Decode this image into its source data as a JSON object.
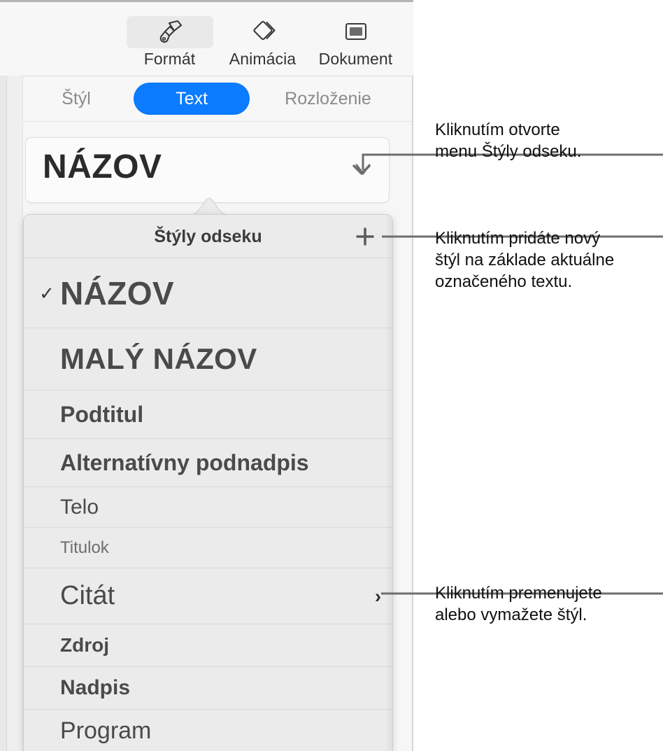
{
  "toolbar": {
    "items": [
      {
        "label": "Formát",
        "icon": "paintbrush-icon",
        "selected": true
      },
      {
        "label": "Animácia",
        "icon": "diamonds-icon",
        "selected": false
      },
      {
        "label": "Dokument",
        "icon": "document-frame-icon",
        "selected": false
      }
    ]
  },
  "tabs": {
    "items": [
      {
        "label": "Štýl",
        "selected": false
      },
      {
        "label": "Text",
        "selected": true
      },
      {
        "label": "Rozloženie",
        "selected": false
      }
    ],
    "accent_color": "#0b7bff"
  },
  "style_field": {
    "value": "NÁZOV",
    "chevron_icon": "chevron-down-icon"
  },
  "popup": {
    "title": "Štýly odseku",
    "add_icon": "plus-icon",
    "rows": [
      {
        "label": "NÁZOV",
        "checked": true,
        "submenu": false,
        "class": "r-nazov"
      },
      {
        "label": "MALÝ NÁZOV",
        "checked": false,
        "submenu": false,
        "class": "r-maly"
      },
      {
        "label": "Podtitul",
        "checked": false,
        "submenu": false,
        "class": "r-podtitul"
      },
      {
        "label": "Alternatívny podnadpis",
        "checked": false,
        "submenu": false,
        "class": "r-alt"
      },
      {
        "label": "Telo",
        "checked": false,
        "submenu": false,
        "class": "r-telo"
      },
      {
        "label": "Titulok",
        "checked": false,
        "submenu": false,
        "class": "r-titulok"
      },
      {
        "label": "Citát",
        "checked": false,
        "submenu": true,
        "class": "r-citat"
      },
      {
        "label": "Zdroj",
        "checked": false,
        "submenu": false,
        "class": "r-zdroj"
      },
      {
        "label": "Nadpis",
        "checked": false,
        "submenu": false,
        "class": "r-nadpis"
      },
      {
        "label": "Program",
        "checked": false,
        "submenu": false,
        "class": "r-program"
      }
    ],
    "check_glyph": "✓",
    "submenu_glyph": "›"
  },
  "callouts": {
    "one": "Kliknutím otvorte\nmenu Štýly odseku.",
    "two": "Kliknutím pridáte nový\nštýl na základe aktuálne\noznačeného textu.",
    "three": "Kliknutím premenujete\nalebo vymažete štýl."
  }
}
